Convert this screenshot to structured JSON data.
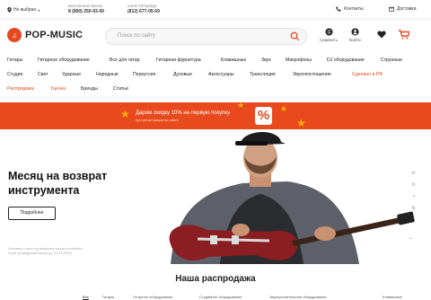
{
  "topbar": {
    "city": "Не выбран",
    "phone1_note": "Бесплатный звонок",
    "phone1": "8 (800) 250-93-00",
    "phone2_note": "Санкт-Петербург",
    "phone2": "(812) 677-05-59",
    "contacts": "Контакты",
    "delivery": "Доставка"
  },
  "header": {
    "logo": "POP-MUSIC",
    "search_placeholder": "Поиск по сайту",
    "compare": "Сравнить",
    "login": "Войти"
  },
  "nav": {
    "row1": [
      "Гитары",
      "Гитарное оборудование",
      "Все для гитар",
      "Гитарная фурнитура",
      "Клавишные",
      "Звук",
      "Микрофоны",
      "DJ оборудование",
      "Струнные"
    ],
    "row2": [
      "Студия",
      "Свет",
      "Ударные",
      "Народные",
      "Перкуссия",
      "Духовые",
      "Аксессуары",
      "Трансляция",
      "Звукопоглощение",
      "Сделано в РФ"
    ],
    "row3": [
      "Распродажа",
      "Уценка",
      "Бренды",
      "Статьи"
    ]
  },
  "banner": {
    "text": "Дарим скидку 10% на первую покупку",
    "subtext": "при регистрации на сайте",
    "percent": "%"
  },
  "hero": {
    "title": "Месяц на возврат инструмента",
    "button": "Подробнее",
    "legal1": "Условия и срок проведения акции уточняйте",
    "legal2": "Срок проведения акции до 31.12.2025"
  },
  "sale": {
    "title": "Наша распродажа",
    "categories": [
      "Все",
      "Гитары",
      "Гитарное оборудование",
      "Студийное оборудование",
      "Звукоусилительное оборудование",
      "Клавишные"
    ]
  },
  "colors": {
    "brand": "#e8491d",
    "star": "#f7b500"
  }
}
